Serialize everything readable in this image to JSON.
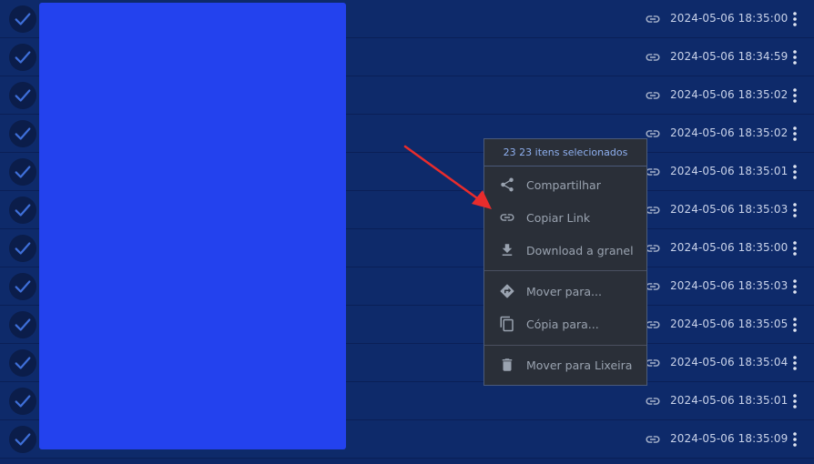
{
  "rows": [
    {
      "date": "2024-05-06 18:35:00"
    },
    {
      "date": "2024-05-06 18:34:59"
    },
    {
      "date": "2024-05-06 18:35:02"
    },
    {
      "date": "2024-05-06 18:35:02"
    },
    {
      "date": "2024-05-06 18:35:01"
    },
    {
      "date": "2024-05-06 18:35:03"
    },
    {
      "date": "2024-05-06 18:35:00"
    },
    {
      "date": "2024-05-06 18:35:03"
    },
    {
      "date": "2024-05-06 18:35:05"
    },
    {
      "date": "2024-05-06 18:35:04"
    },
    {
      "date": "2024-05-06 18:35:01"
    },
    {
      "date": "2024-05-06 18:35:09"
    }
  ],
  "menu": {
    "header": "23 23 itens selecionados",
    "items": [
      {
        "label": "Compartilhar",
        "icon": "share-icon"
      },
      {
        "label": "Copiar Link",
        "icon": "link-icon"
      },
      {
        "label": "Download a granel",
        "icon": "download-icon"
      },
      {
        "label": "Mover para...",
        "icon": "move-icon"
      },
      {
        "label": "Cópia para...",
        "icon": "copy-icon"
      },
      {
        "label": "Mover para Lixeira",
        "icon": "trash-icon"
      }
    ]
  },
  "colors": {
    "background": "#0e2a6a",
    "selection_blue": "#2342ee",
    "menu_bg": "#2a2f38",
    "annotation_arrow": "#e82c2c"
  }
}
